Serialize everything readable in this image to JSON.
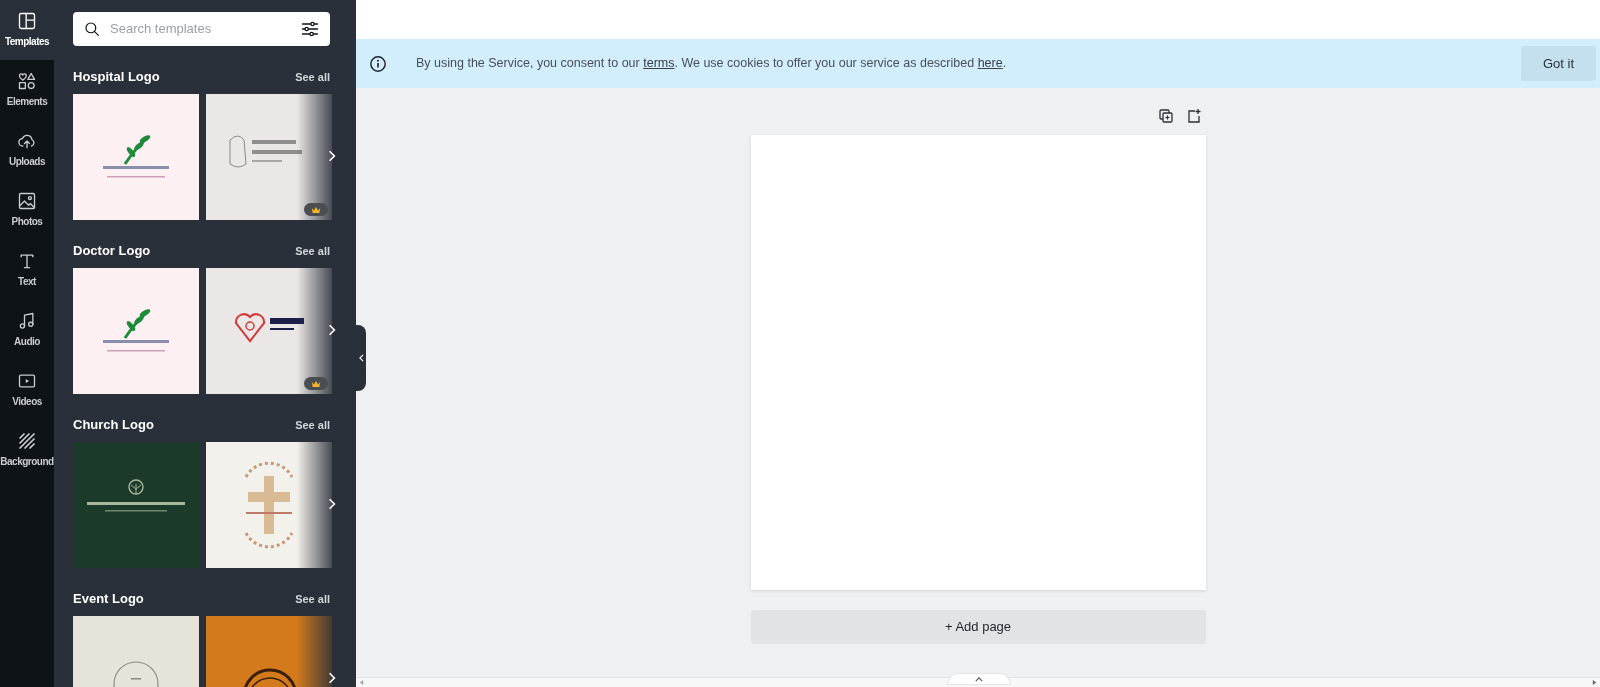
{
  "sidebar": {
    "items": [
      {
        "kind": "templates",
        "label": "Templates",
        "selected": true
      },
      {
        "kind": "elements",
        "label": "Elements",
        "selected": false
      },
      {
        "kind": "uploads",
        "label": "Uploads",
        "selected": false
      },
      {
        "kind": "photos",
        "label": "Photos",
        "selected": false
      },
      {
        "kind": "text",
        "label": "Text",
        "selected": false
      },
      {
        "kind": "audio",
        "label": "Audio",
        "selected": false
      },
      {
        "kind": "videos",
        "label": "Videos",
        "selected": false
      },
      {
        "kind": "background",
        "label": "Background",
        "selected": false
      }
    ]
  },
  "search": {
    "placeholder": "Search templates"
  },
  "sections": [
    {
      "title": "Hospital Logo",
      "see_all": "See all",
      "templates": [
        {
          "kind": "picture",
          "premium": false
        },
        {
          "kind": "picture",
          "premium": true
        }
      ]
    },
    {
      "title": "Doctor Logo",
      "see_all": "See all",
      "templates": [
        {
          "kind": "picture",
          "premium": false
        },
        {
          "kind": "picture",
          "premium": true
        }
      ]
    },
    {
      "title": "Church Logo",
      "see_all": "See all",
      "templates": [
        {
          "kind": "picture",
          "premium": false
        },
        {
          "kind": "picture",
          "premium": false
        }
      ]
    },
    {
      "title": "Event Logo",
      "see_all": "See all",
      "templates": [
        {
          "kind": "picture",
          "premium": false
        },
        {
          "kind": "picture",
          "premium": false
        }
      ]
    }
  ],
  "cookie_banner": {
    "before": "By using the Service, you consent to our ",
    "link_1": "terms",
    "middle": ". We use cookies to offer you our service as described ",
    "link_2": "here",
    "after": ".",
    "button": "Got it"
  },
  "add_page": "+ Add page"
}
